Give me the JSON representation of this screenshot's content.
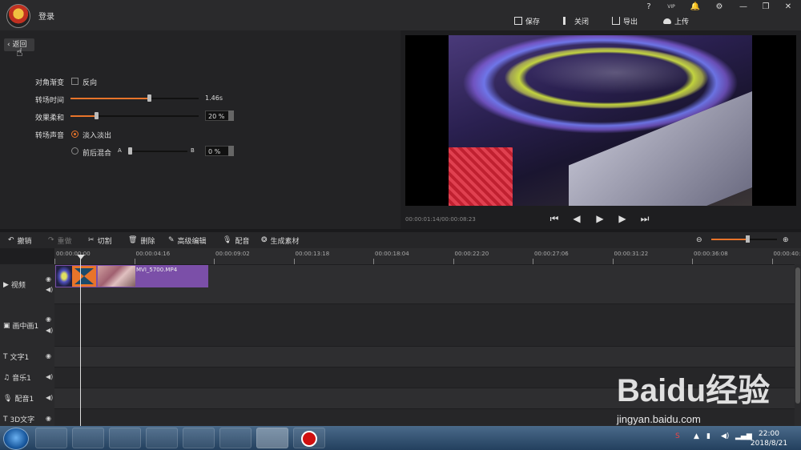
{
  "app": {
    "login_label": "登录"
  },
  "window_controls": [
    "?",
    "VIP",
    "🔔",
    "⚙",
    "—",
    "❐",
    "✕"
  ],
  "top_actions": [
    {
      "label": "保存",
      "icon": "save-icon"
    },
    {
      "label": "关闭",
      "icon": "exit-icon"
    },
    {
      "label": "导出",
      "icon": "export-icon"
    },
    {
      "label": "上传",
      "icon": "cloud-upload-icon"
    }
  ],
  "left_panel": {
    "back_label": "返回",
    "diagonal": {
      "label": "对角渐变",
      "reverse_label": "反向",
      "reverse_checked": false
    },
    "duration": {
      "label": "转场时间",
      "value_text": "1.46s",
      "level": 0.61
    },
    "softness": {
      "label": "效果柔和",
      "value_text": "20 %",
      "level": 0.2
    },
    "sound": {
      "label": "转场声音",
      "option1": "淡入淡出",
      "option2": "前后混合",
      "option1_selected": true
    },
    "mix": {
      "a_label": "A",
      "b_label": "B",
      "value_text": "0 %",
      "level": 0.0
    }
  },
  "preview": {
    "timecode": "00:00:01:14/00:00:08:23"
  },
  "toolbar": {
    "undo": "撤销",
    "redo": "重做",
    "cut": "切割",
    "delete": "删除",
    "advanced": "高级编辑",
    "dub": "配音",
    "generate": "生成素材",
    "zoom_level": 0.55
  },
  "ruler_labels": [
    "00:00:00:00",
    "00:00:04:16",
    "00:00:09:02",
    "00:00:13:18",
    "00:00:18:04",
    "00:00:22:20",
    "00:00:27:06",
    "00:00:31:22",
    "00:00:36:08",
    "00:00:40:"
  ],
  "tracks": [
    {
      "label": "视频",
      "icon": "play-square-icon"
    },
    {
      "label": "画中画1",
      "icon": "pip-icon"
    },
    {
      "label": "文字1",
      "icon": "text-icon"
    },
    {
      "label": "音乐1",
      "icon": "music-icon"
    },
    {
      "label": "配音1",
      "icon": "mic-icon"
    },
    {
      "label": "3D文字",
      "icon": "text-3d-icon"
    }
  ],
  "clip": {
    "name": "MVI_5700.MP4"
  },
  "taskbar": {
    "time": "22:00",
    "date": "2018/8/21"
  },
  "watermark": {
    "brand": "Baidu经验",
    "url": "jingyan.baidu.com"
  }
}
